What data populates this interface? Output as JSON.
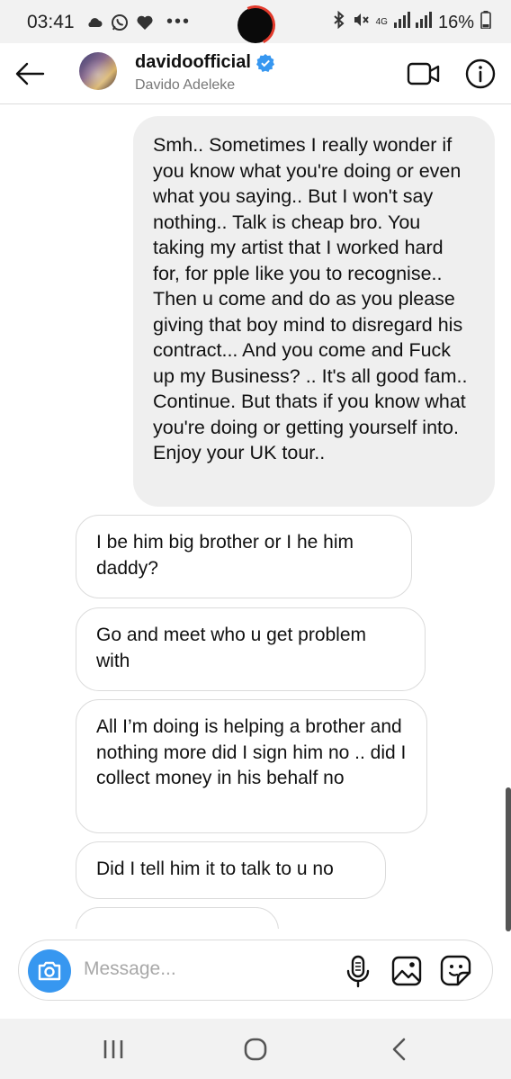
{
  "status_bar": {
    "time": "03:41",
    "network": "4G",
    "battery": "16%",
    "icons": [
      "cloud-icon",
      "whatsapp-icon",
      "heart-icon",
      "more-dots-icon",
      "bluetooth-icon",
      "mute-icon",
      "signal-icon",
      "battery-icon"
    ]
  },
  "header": {
    "username": "davidoofficial",
    "full_name": "Davido Adeleke",
    "verified": true
  },
  "messages": {
    "outgoing": [
      "Smh.. Sometimes I really wonder if you know what you're doing or even what you saying.. But I won't say nothing.. Talk is cheap bro. You taking my artist that I worked hard for, for pple like you to recognise.. Then u come and do as you please giving that boy mind to disregard his contract... And you come and Fuck up my Business? .. It's all good fam.. Continue. But thats if you know what you're doing or getting yourself into. Enjoy your UK tour.."
    ],
    "incoming": [
      "I be him big brother or I he him daddy?",
      "Go and meet who u get problem with",
      "All I’m doing is helping a brother and nothing more did I sign him no .. did I collect money in his behalf no",
      "Did I tell him it to talk to u no",
      ""
    ]
  },
  "composer": {
    "placeholder": "Message...",
    "value": ""
  },
  "colors": {
    "accent": "#3797f0",
    "verified": "#3797f0",
    "bubble_out": "#efefef",
    "bubble_in_border": "#dbdbdb",
    "recording_ring": "#e23a2c"
  }
}
